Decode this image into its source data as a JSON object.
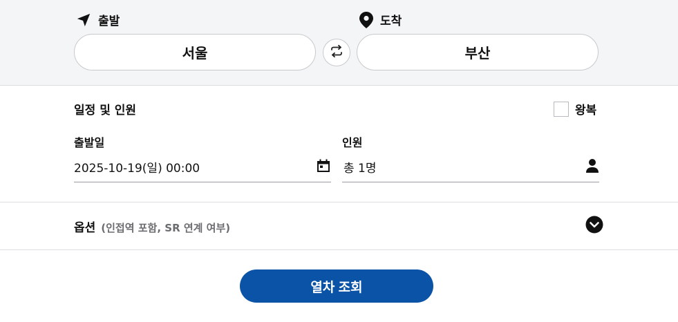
{
  "route": {
    "departure_label": "출발",
    "arrival_label": "도착",
    "departure_station": "서울",
    "arrival_station": "부산"
  },
  "schedule": {
    "title": "일정 및 인원",
    "roundtrip_label": "왕복",
    "roundtrip_checked": false,
    "date_label": "출발일",
    "date_value": "2025-10-19(일) 00:00",
    "passenger_label": "인원",
    "passenger_value": "총 1명"
  },
  "options": {
    "title": "옵션",
    "subtitle": "(인접역 포함, SR 연계 여부)"
  },
  "search_button_label": "열차 조회",
  "icons": {
    "departure": "navigation-arrow-icon",
    "arrival": "map-pin-icon",
    "swap": "swap-arrows-icon",
    "calendar": "calendar-icon",
    "person": "person-icon",
    "expand": "chevron-down-circle-icon"
  },
  "colors": {
    "primary": "#0b53a6",
    "band_background": "#f4f5f7"
  }
}
